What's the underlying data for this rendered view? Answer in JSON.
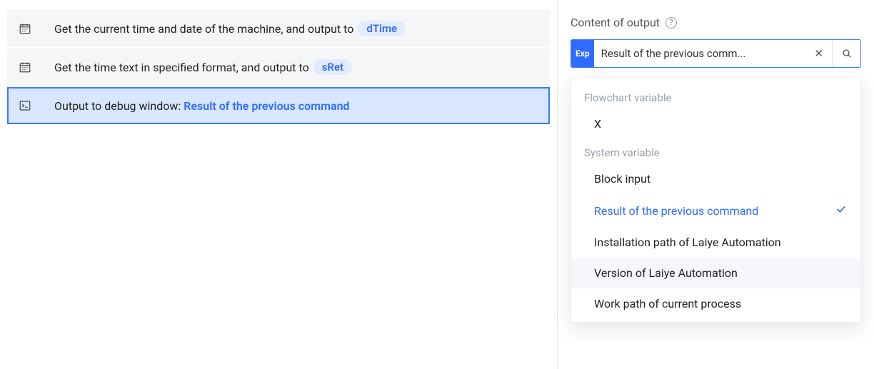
{
  "steps": [
    {
      "icon": "calendar-icon",
      "text_prefix": "Get the current time and date of the machine, and output to",
      "output_pill": "dTime",
      "selected": false
    },
    {
      "icon": "calendar-icon",
      "text_prefix": "Get the time text in specified format, and output to",
      "output_pill": "sRet",
      "selected": false
    },
    {
      "icon": "terminal-icon",
      "text_prefix": "Output to debug window: ",
      "blue_text": "Result of the previous command",
      "selected": true
    }
  ],
  "panel": {
    "title": "Content of output",
    "help_glyph": "?",
    "exp_badge": "Exp",
    "current_value_display": "Result of the previous comm...",
    "clear_glyph": "✕"
  },
  "dropdown": {
    "groups": [
      {
        "label": "Flowchart variable",
        "items": [
          {
            "label": "X",
            "selected": false,
            "hovered": false
          }
        ]
      },
      {
        "label": "System variable",
        "items": [
          {
            "label": "Block input",
            "selected": false,
            "hovered": false
          },
          {
            "label": "Result of the previous command",
            "selected": true,
            "hovered": false
          },
          {
            "label": "Installation path of Laiye Automation",
            "selected": false,
            "hovered": false
          },
          {
            "label": "Version of Laiye Automation",
            "selected": false,
            "hovered": true
          },
          {
            "label": "Work path of current process",
            "selected": false,
            "hovered": false
          }
        ]
      }
    ]
  }
}
